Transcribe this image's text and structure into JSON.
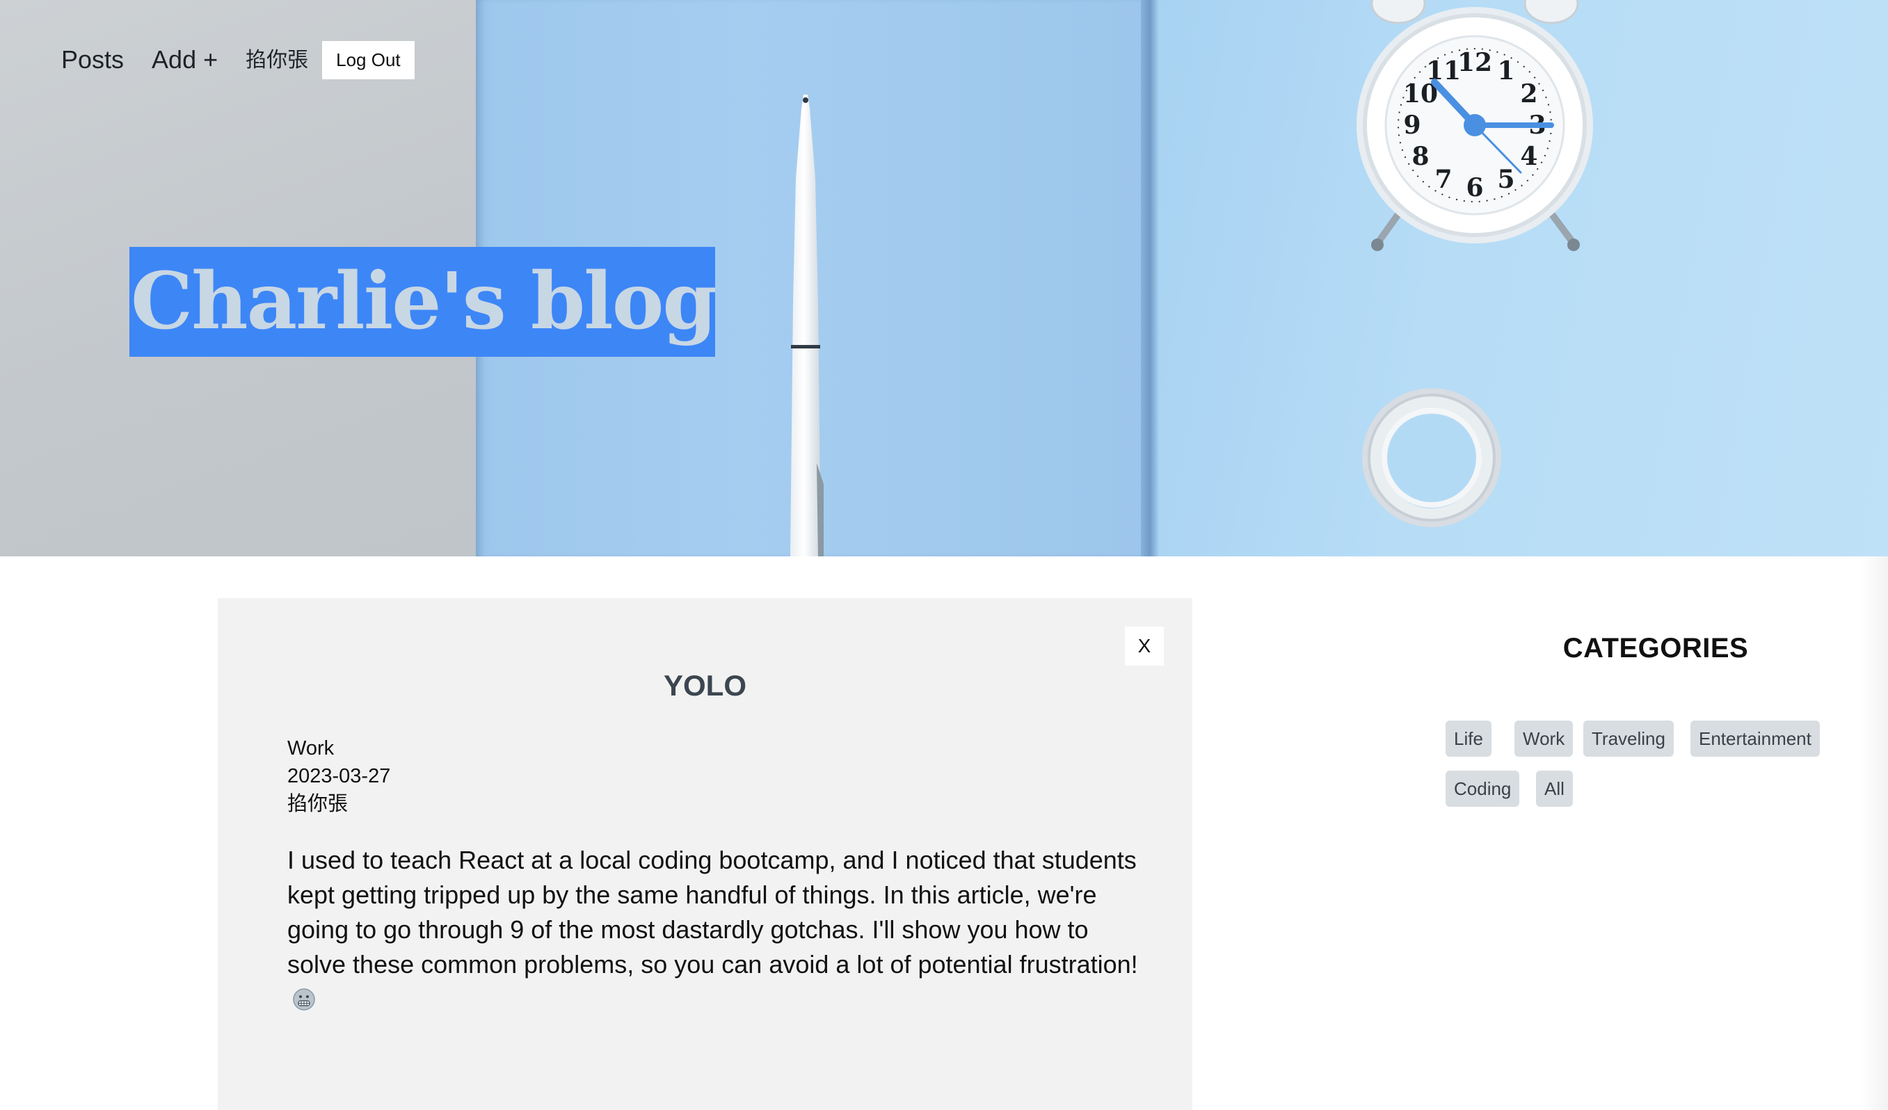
{
  "nav": {
    "posts_label": "Posts",
    "add_label": "Add +",
    "username": "掐你張",
    "logout_label": "Log Out"
  },
  "hero": {
    "blog_title": "Charlie's blog",
    "clock_numbers": [
      "12",
      "1",
      "2",
      "3",
      "4",
      "5",
      "6",
      "7",
      "8",
      "9",
      "10",
      "11"
    ]
  },
  "post": {
    "close_label": "X",
    "title": "YOLO",
    "category": "Work",
    "date": "2023-03-27",
    "author": "掐你張",
    "body": "I used to teach React at a local coding bootcamp, and I noticed that students kept getting tripped up by the same handful of things. In this article, we're going to go through 9 of the most dastardly gotchas. I'll show you how to solve these common problems, so you can avoid a lot of potential frustration!"
  },
  "sidebar": {
    "title": "CATEGORIES",
    "categories": [
      "Life",
      "Work",
      "Traveling",
      "Entertainment",
      "Coding",
      "All"
    ]
  },
  "colors": {
    "title_highlight": "#3d86f6",
    "card_background": "#f2f2f2",
    "category_chip": "#d8dde1",
    "hero_blue": "#a5cdf0"
  },
  "icons": {
    "emoji": "grimacing-face-icon"
  }
}
